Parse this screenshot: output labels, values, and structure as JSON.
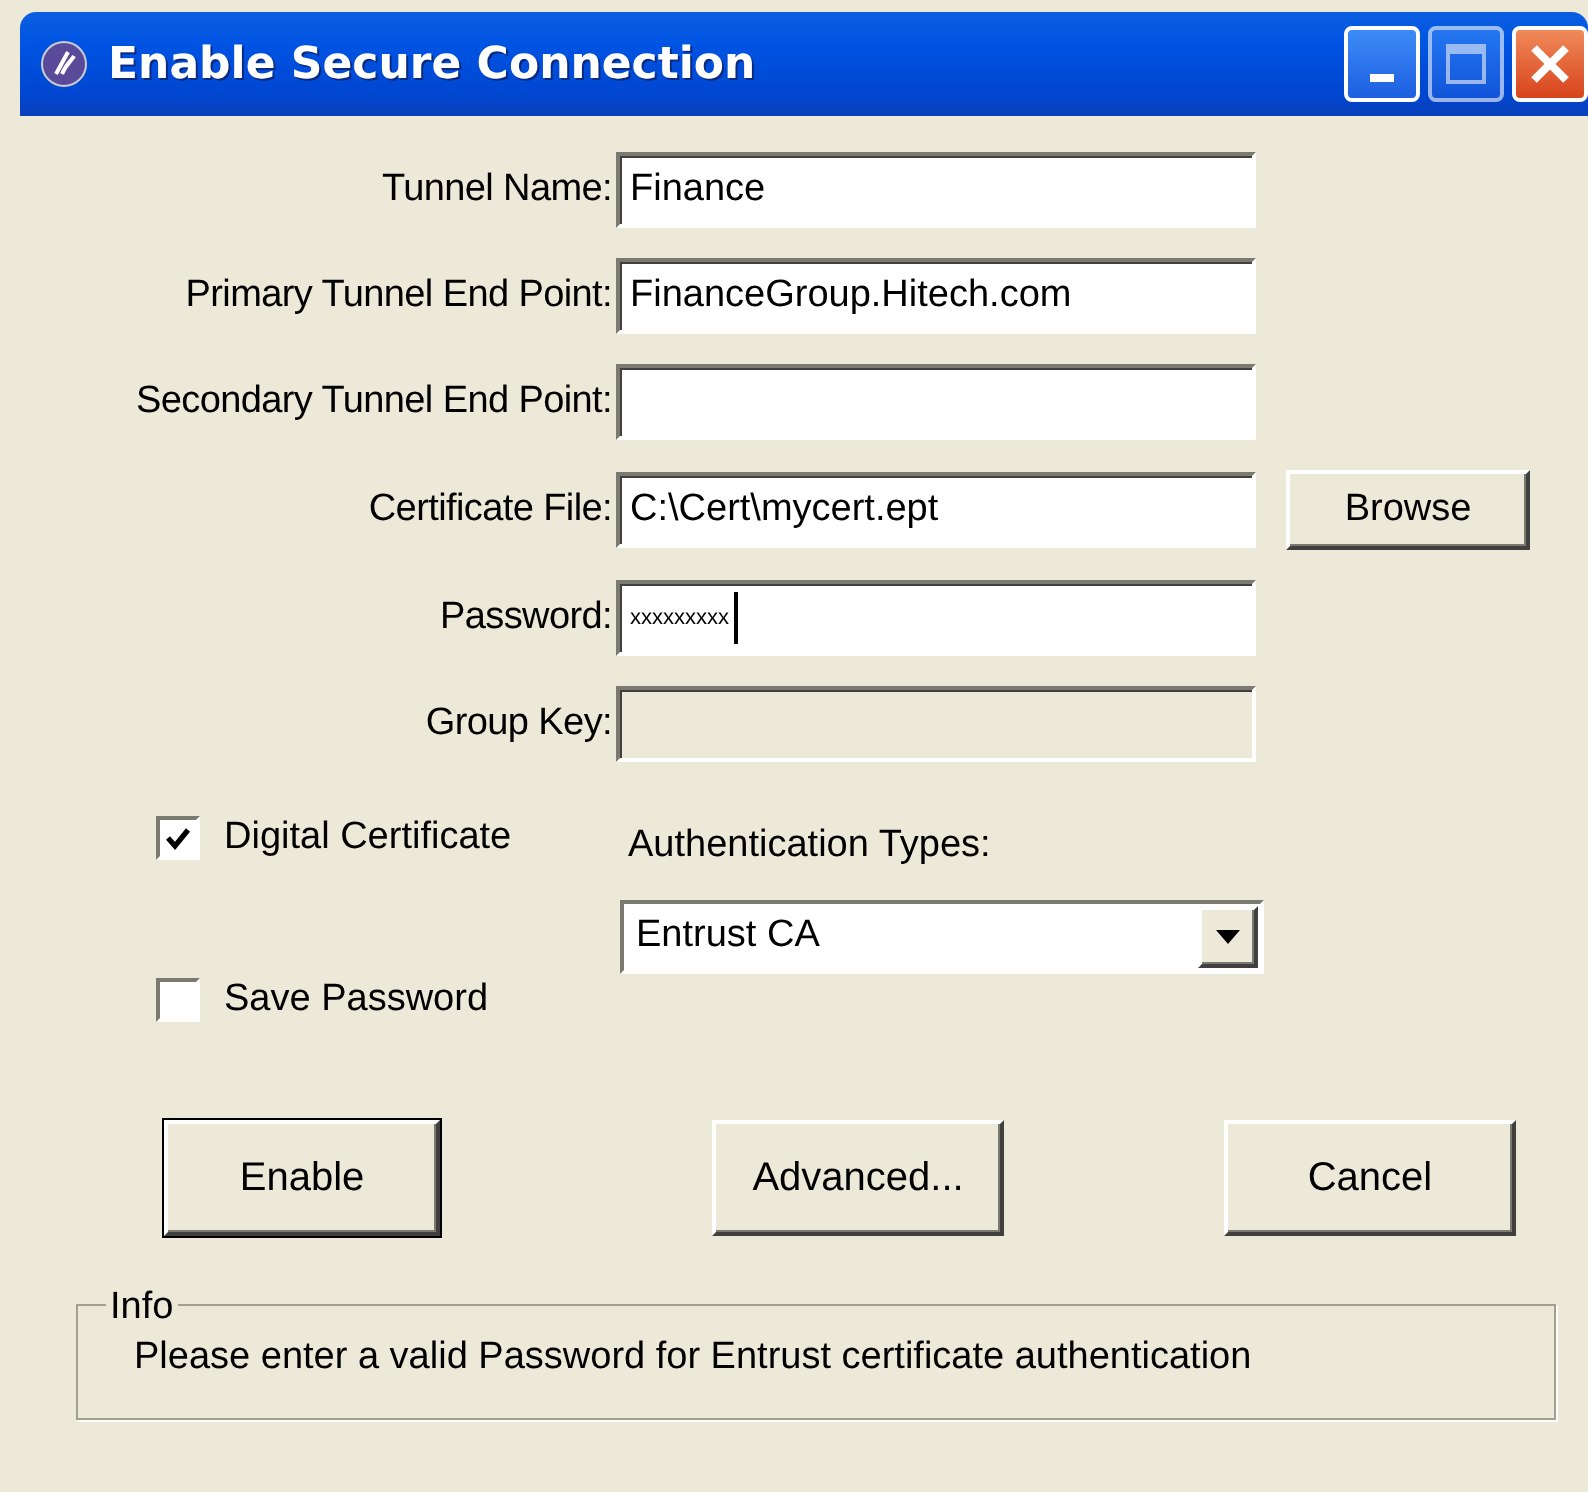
{
  "window": {
    "title": "Enable Secure Connection"
  },
  "fields": [
    {
      "label": "Tunnel Name:",
      "value": "Finance",
      "disabled": false
    },
    {
      "label": "Primary Tunnel End Point:",
      "value": "FinanceGroup.Hitech.com",
      "disabled": false
    },
    {
      "label": "Secondary Tunnel End Point:",
      "disabled": false
    },
    {
      "label": "Certificate File:",
      "value": "C:\\Cert\\mycert.ept",
      "disabled": false,
      "button": "Browse"
    },
    {
      "label": "Password:",
      "value": "xxxxxxxxx",
      "disabled": false,
      "focused": true
    },
    {
      "label": "Group Key:",
      "disabled": true
    }
  ],
  "checkboxes": [
    {
      "label": "Digital Certificate",
      "checked": true
    },
    {
      "label": "Save Password",
      "checked": false
    }
  ],
  "authentication": {
    "label": "Authentication Types:",
    "value": "Entrust CA"
  },
  "buttons": [
    {
      "label": "Enable",
      "default": true
    },
    {
      "label": "Advanced...",
      "default": false
    },
    {
      "label": "Cancel",
      "default": false
    }
  ],
  "info": {
    "legend": "Info",
    "message": "Please enter a valid Password for Entrust certificate authentication"
  }
}
